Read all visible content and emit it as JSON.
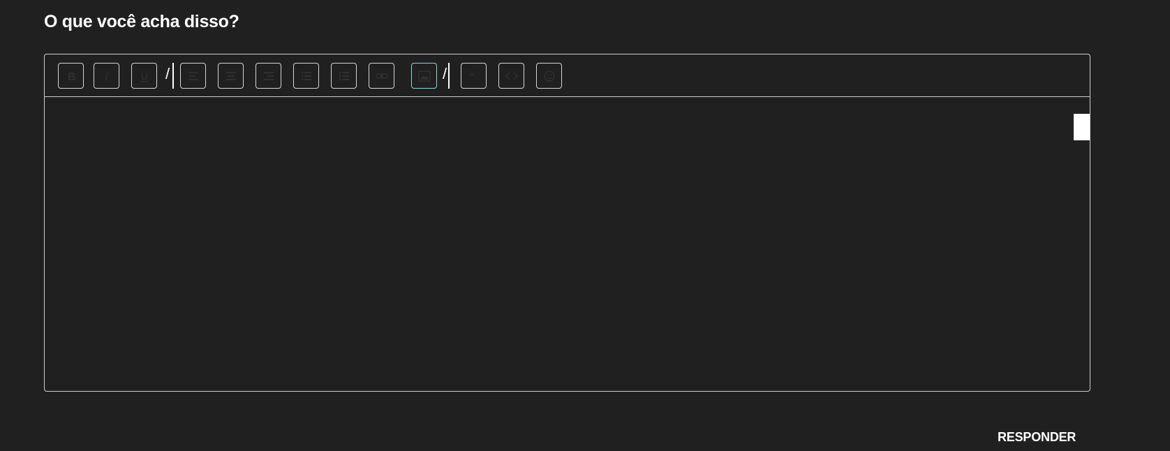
{
  "heading": "O que você acha disso?",
  "toolbar": {
    "separator": "/",
    "groups": [
      [
        "bold-icon",
        "italic-icon",
        "underline-icon"
      ],
      [
        "align-left-icon",
        "align-center-icon",
        "align-right-icon",
        "list-ordered-icon",
        "list-bullet-icon",
        "link-icon",
        "image-icon"
      ],
      [
        "quote-icon",
        "code-icon",
        "emoji-icon"
      ]
    ],
    "active_icon": "image-icon"
  },
  "submit_label": "RESPONDER"
}
